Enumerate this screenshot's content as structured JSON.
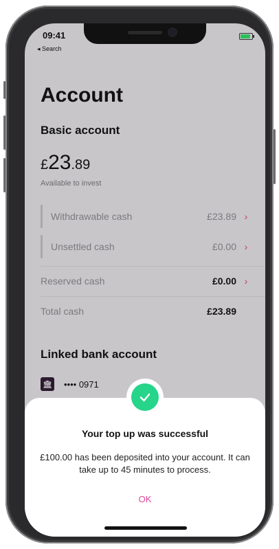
{
  "status_bar": {
    "time": "09:41",
    "back_label": "◂ Search"
  },
  "page": {
    "title": "Account"
  },
  "basic_account": {
    "heading": "Basic account",
    "balance_symbol": "£",
    "balance_int": "23",
    "balance_dec": ".89",
    "caption": "Available to invest",
    "rows": [
      {
        "label": "Withdrawable cash",
        "value": "£23.89"
      },
      {
        "label": "Unsettled cash",
        "value": "£0.00"
      },
      {
        "label": "Reserved cash",
        "value": "£0.00"
      },
      {
        "label": "Total cash",
        "value": "£23.89"
      }
    ]
  },
  "linked_bank": {
    "heading": "Linked bank account",
    "account_mask": "•••• 0971"
  },
  "dialog": {
    "headline": "Your top up was successful",
    "body": "£100.00 has been deposited into your account. It can take up to 45 minutes to process.",
    "ok_label": "OK"
  },
  "colors": {
    "accent": "#c0396a",
    "success": "#26d48a",
    "ok": "#e0449a"
  }
}
